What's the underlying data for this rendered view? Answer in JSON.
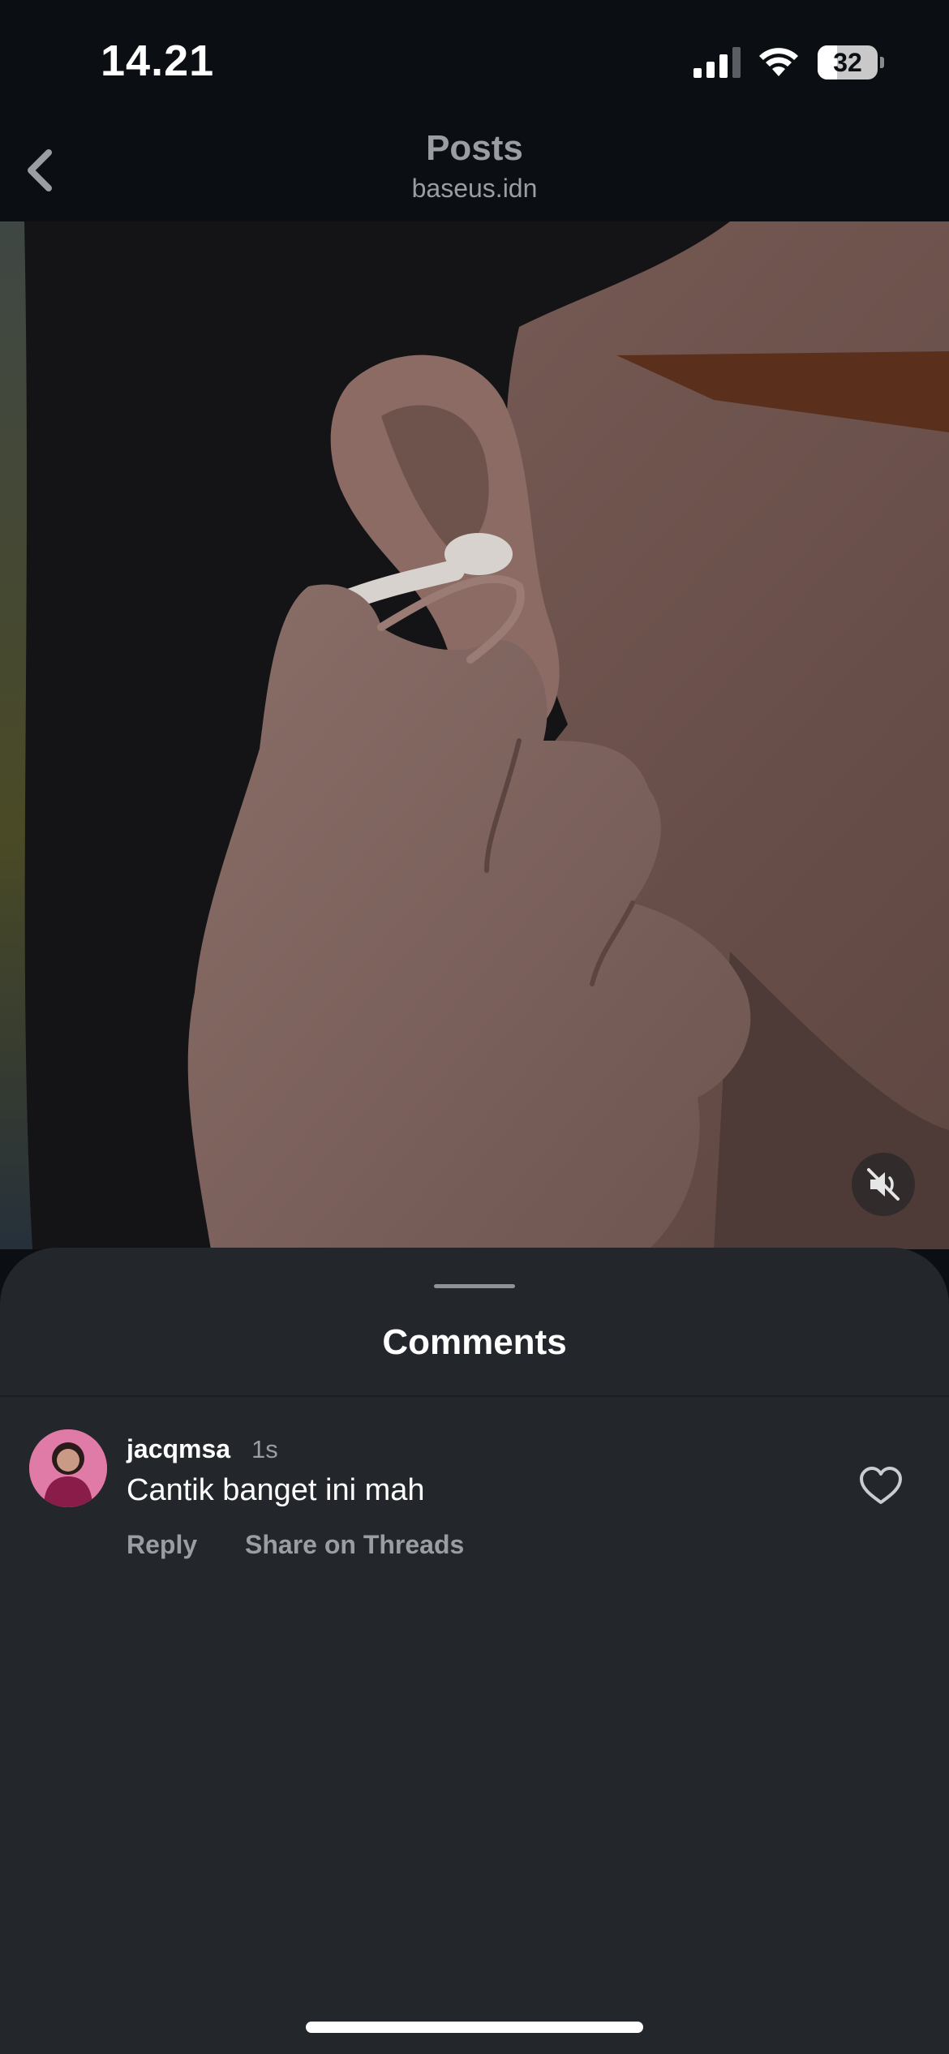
{
  "status_bar": {
    "time": "14.21",
    "battery_level": "32",
    "battery_percent": 32,
    "icons": [
      "signal-icon",
      "wifi-icon",
      "battery-icon"
    ]
  },
  "header": {
    "back_icon": "chevron-left-icon",
    "title": "Posts",
    "subtitle": "baseus.idn"
  },
  "media": {
    "content": "video",
    "mute_icon": "speaker-muted-icon"
  },
  "comments_sheet": {
    "title": "Comments",
    "comments": [
      {
        "username": "jacqmsa",
        "time": "1s",
        "text": "Cantik banget ini mah",
        "reply_label": "Reply",
        "share_label": "Share on Threads",
        "like_icon": "heart-outline-icon"
      }
    ]
  },
  "colors": {
    "background": "#0b0e12",
    "sheet": "#23262b",
    "muted_text": "#9a9da2",
    "text": "#ffffff"
  }
}
